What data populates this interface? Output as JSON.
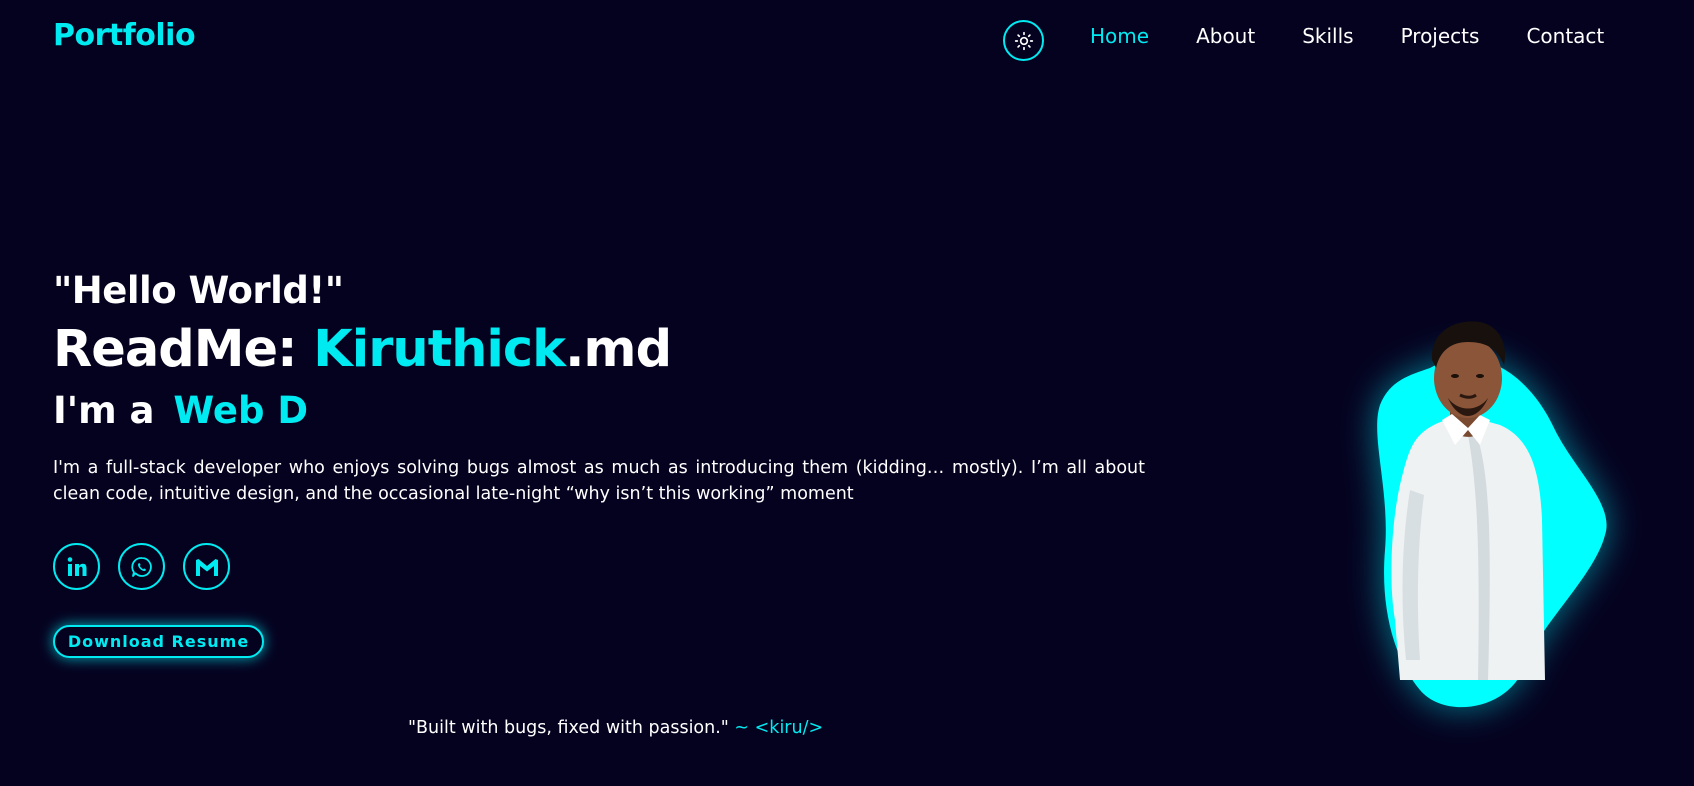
{
  "nav": {
    "logo": "Portfolio",
    "theme_icon": "sun-icon",
    "links": [
      {
        "label": "Home",
        "active": true
      },
      {
        "label": "About",
        "active": false
      },
      {
        "label": "Skills",
        "active": false
      },
      {
        "label": "Projects",
        "active": false
      },
      {
        "label": "Contact",
        "active": false
      }
    ]
  },
  "hero": {
    "greeting": "\"Hello World!\"",
    "readme_prefix": "ReadMe: ",
    "readme_name": "Kiruthick",
    "readme_suffix": ".md",
    "role_prefix": "I'm a",
    "role_typed": "Web D",
    "bio": "I'm a full-stack developer who enjoys solving bugs almost as much as introducing them (kidding… mostly). I’m all about clean code, intuitive design, and the occasional late-night “why isn’t this working” moment"
  },
  "socials": [
    {
      "icon": "linkedin-icon"
    },
    {
      "icon": "whatsapp-icon"
    },
    {
      "icon": "gmail-icon"
    }
  ],
  "resume_button": "Download Resume",
  "quote": {
    "text": "\"Built with bugs, fixed with passion.\"",
    "signature": " ~ <kiru/>"
  },
  "colors": {
    "background": "#05021f",
    "accent": "#00eaf2",
    "text": "#ffffff"
  }
}
